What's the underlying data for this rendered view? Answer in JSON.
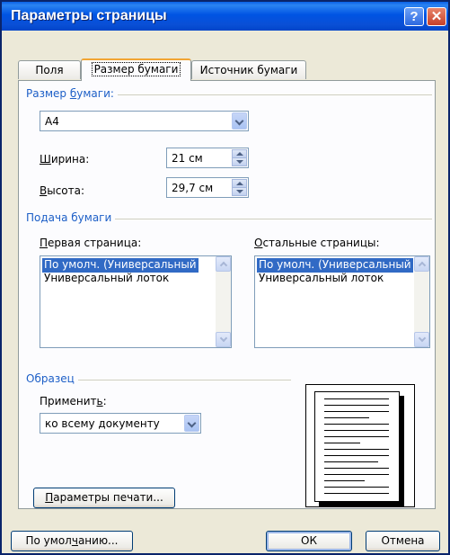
{
  "window": {
    "title": "Параметры страницы",
    "help_glyph": "?",
    "close_glyph": "✕"
  },
  "tabs": [
    {
      "label": "Поля",
      "active": false
    },
    {
      "label": "Размер бумаги",
      "active": true
    },
    {
      "label": "Источник бумаги",
      "active": false
    }
  ],
  "paper_size": {
    "group_label_pre": "Размер ",
    "group_label_u": "б",
    "group_label_post": "умаги:",
    "selected": "А4",
    "width": {
      "label_u": "Ш",
      "label_rest": "ирина:",
      "value": "21 см"
    },
    "height": {
      "label_u": "В",
      "label_rest": "ысота:",
      "value": "29,7 см"
    }
  },
  "paper_source": {
    "group_label": "Подача бумаги",
    "first_page": {
      "label_u": "П",
      "label_rest": "ервая страница:",
      "items": [
        "По умолч. (Универсальный",
        "Универсальный лоток"
      ],
      "selected_index": 0
    },
    "other_pages": {
      "label_u": "О",
      "label_rest": "стальные страницы:",
      "items": [
        "По умолч. (Универсальный",
        "Универсальный лоток"
      ],
      "selected_index": 0
    }
  },
  "sample": {
    "group_label": "Образец",
    "apply_label_pre": "Применит",
    "apply_label_u": "ь",
    "apply_label_post": ":",
    "apply_value": "ко всему документу"
  },
  "buttons": {
    "print_options_pre": "",
    "print_options_u": "П",
    "print_options_post": "араметры печати...",
    "default_pre": "По умол",
    "default_u": "ч",
    "default_post": "анию...",
    "ok": "ОК",
    "cancel": "Отмена"
  },
  "colors": {
    "title_bar": "#0054e3",
    "group_label": "#1d5fc7",
    "selection": "#316ac5",
    "dialog_bg": "#ece9d8"
  }
}
